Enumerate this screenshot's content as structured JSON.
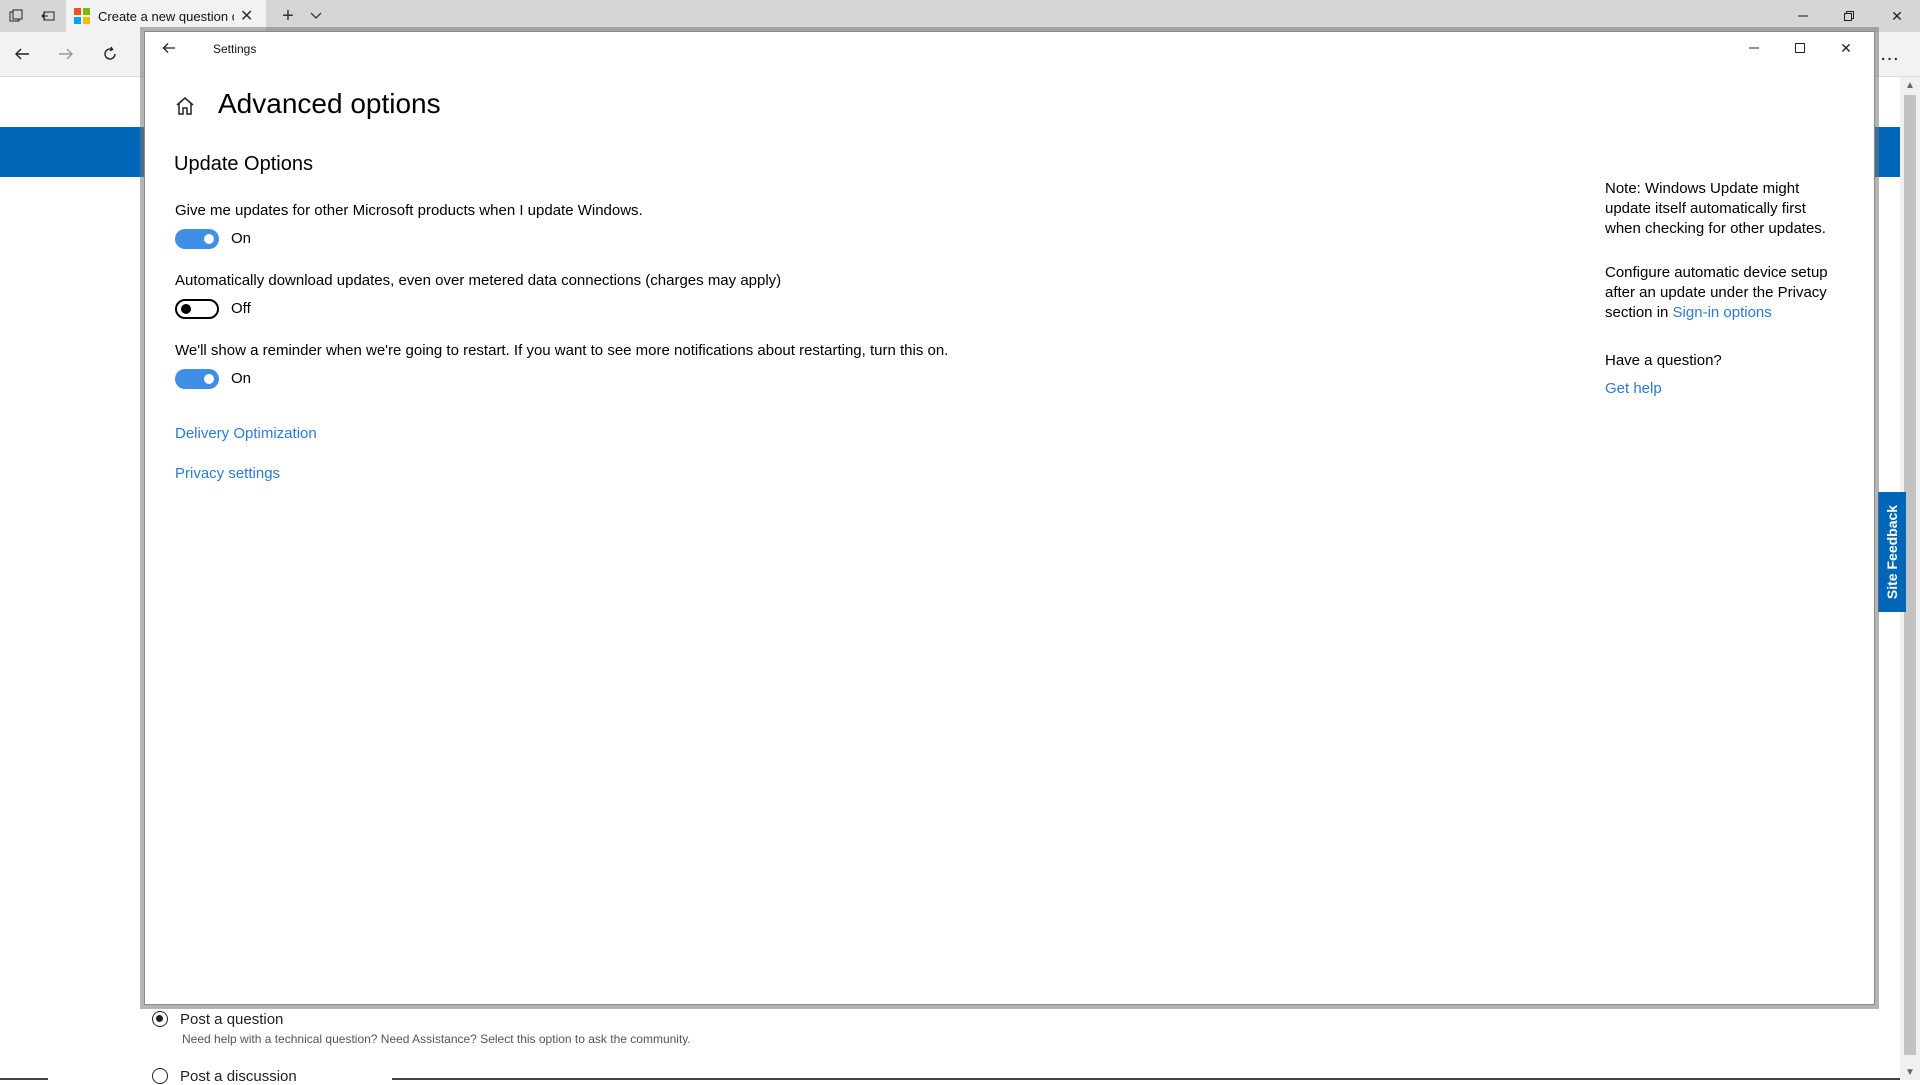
{
  "browser": {
    "tab_title": "Create a new question c",
    "favicon_colors": [
      "#f25022",
      "#7fba00",
      "#00a4ef",
      "#ffb900"
    ]
  },
  "background_page": {
    "site_feedback": "Site Feedback",
    "post_question_label": "Post a question",
    "post_question_desc": "Need help with a technical question? Need Assistance? Select this option to ask the community.",
    "post_discussion_label": "Post a discussion"
  },
  "settings": {
    "window_title": "Settings",
    "page_title": "Advanced options",
    "section_title": "Update Options",
    "options": [
      {
        "description": "Give me updates for other Microsoft products when I update Windows.",
        "state": "On"
      },
      {
        "description": "Automatically download updates, even over metered data connections (charges may apply)",
        "state": "Off"
      },
      {
        "description": "We'll show a reminder when we're going to restart. If you want to see more notifications about restarting, turn this on.",
        "state": "On"
      }
    ],
    "links": {
      "delivery_optimization": "Delivery Optimization",
      "privacy_settings": "Privacy settings"
    },
    "side": {
      "note": "Note: Windows Update might update itself automatically first when checking for other updates.",
      "configure_text": "Configure automatic device setup after an update under the Privacy section in",
      "sign_in_link": "Sign-in options",
      "question": "Have a question?",
      "get_help": "Get help"
    }
  },
  "colors": {
    "accent": "#0067b8",
    "link": "#2c7ad2",
    "toggle_on": "#3f8fe6"
  }
}
